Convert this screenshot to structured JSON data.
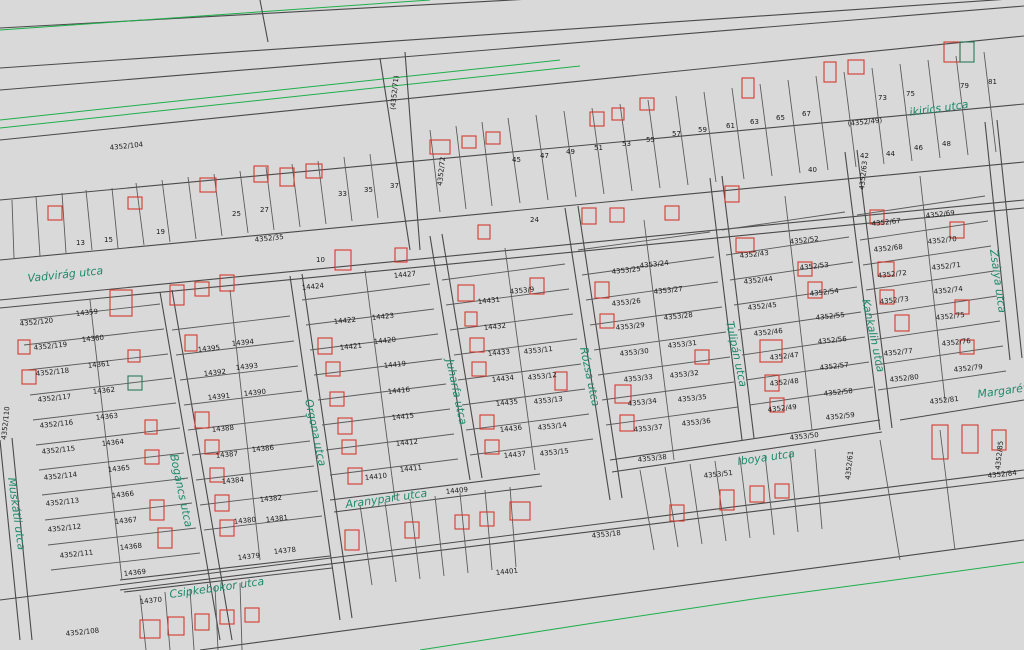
{
  "colors": {
    "background": "#d9d9d9",
    "parcel_line": "#5b5b5b",
    "building": "#d43a2f",
    "street_label": "#1e8a6a",
    "contour": "#1fae4b"
  },
  "streets": {
    "vadvirag": "Vadvirág utca",
    "bogancs": "Bogáncs utca",
    "orgona": "Orgona utca",
    "juharfa": "Juharfa utca",
    "rozsa": "Rózsa utca",
    "tulipan": "Tulipán utca",
    "kankalin": "Kankalin utca",
    "zsalya": "Zsálya utca",
    "margareta": "Margaréta",
    "iboya": "Iboya utca",
    "aranypart": "Aranypart utca",
    "csipkebokor": "Csipkebokor utca",
    "muskatli": "Muskátli utca",
    "kikirics": "ikirics utca"
  },
  "parcels": {
    "p4352_104": "4352/104",
    "p4352_49": "(4352/49)",
    "p4352_35": "4352/35",
    "p4352_71": "(4352/71)",
    "p4352_72": "4352/72",
    "p4352_120": "4352/120",
    "p4352_119": "4352/119",
    "p4352_118": "4352/118",
    "p4352_117": "4352/117",
    "p4352_116": "4352/116",
    "p4352_115": "4352/115",
    "p4352_114": "4352/114",
    "p4352_113": "4352/113",
    "p4352_112": "4352/112",
    "p4352_111": "4352/111",
    "p4352_108": "4352/108",
    "p4352_110": "4352/110",
    "p4353_18": "4353/18",
    "p4353_51": "4353/51",
    "p4353_50": "4353/50",
    "p4352_61": "4352/61",
    "p4352_63": "4352/63",
    "p4352_81": "4352/81",
    "p4352_85": "4352/85",
    "p4352_84": "4352/84",
    "n14359": "14359",
    "n14360": "14360",
    "n14361": "14361",
    "n14362": "14362",
    "n14363": "14363",
    "n14364": "14364",
    "n14365": "14365",
    "n14366": "14366",
    "n14367": "14367",
    "n14368": "14368",
    "n14369": "14369",
    "n14370": "14370",
    "n14401": "14401",
    "n14409": "14409",
    "n14424": "14424",
    "n14422": "14422",
    "n14421": "14421",
    "n14420": "14420",
    "n14419": "14419",
    "n14416": "14416",
    "n14415": "14415",
    "n14412": "14412",
    "n14411": "14411",
    "n14410": "14410",
    "n14423": "14423",
    "n14427": "14427",
    "n14431": "14431",
    "n14432": "14432",
    "n14433": "14433",
    "n14434": "14434",
    "n14435": "14435",
    "n14436": "14436",
    "n14437": "14437",
    "n14394": "14394",
    "n14393": "14393",
    "n14392": "14392",
    "n14391": "14391",
    "n14390": "14390",
    "n14395": "14395",
    "n14388": "14388",
    "n14387": "14387",
    "n14386": "14386",
    "n14384": "14384",
    "n14382": "14382",
    "n14381": "14381",
    "n14380": "14380",
    "n14379": "14379",
    "n14378": "14378",
    "r4353_24": "4353/24",
    "r4353_25": "4353/25",
    "r4353_26": "4353/26",
    "r4353_27": "4353/27",
    "r4353_28": "4353/28",
    "r4353_29": "4353/29",
    "r4353_30": "4353/30",
    "r4353_31": "4353/31",
    "r4353_32": "4353/32",
    "r4353_33": "4353/33",
    "r4353_34": "4353/34",
    "r4353_35": "4353/35",
    "r4353_36": "4353/36",
    "r4353_37": "4353/37",
    "r4353_38": "4353/38",
    "r4353_9": "4353/9",
    "r4353_11": "4353/11",
    "r4353_12": "4353/12",
    "r4353_13": "4353/13",
    "r4353_14": "4353/14",
    "r4353_15": "4353/15",
    "r4352_43": "4352/43",
    "r4352_44": "4352/44",
    "r4352_45": "4352/45",
    "r4352_46": "4352/46",
    "r4352_47": "4352/47",
    "r4352_48": "4352/48",
    "r4352_49": "4352/49",
    "r4352_52": "4352/52",
    "r4352_53": "4352/53",
    "r4352_54": "4352/54",
    "r4352_55": "4352/55",
    "r4352_56": "4352/56",
    "r4352_57": "4352/57",
    "r4352_58": "4352/58",
    "r4352_59": "4352/59",
    "r4352_67": "4352/67",
    "r4352_68": "4352/68",
    "r4352_69": "4352/69",
    "r4352_70": "4352/70",
    "r4352_71": "4352/71",
    "r4352_72": "4352/72",
    "r4352_73": "4352/73",
    "r4352_74": "4352/74",
    "r4352_75": "4352/75",
    "r4352_76": "4352/76",
    "r4352_77": "4352/77",
    "r4352_79": "4352/79",
    "r4352_80": "4352/80",
    "h13": "13",
    "h15": "15",
    "h19": "19",
    "h25": "25",
    "h27": "27",
    "h33": "33",
    "h35": "35",
    "h37": "37",
    "h45": "45",
    "h47": "47",
    "h49": "49",
    "h51": "51",
    "h53": "53",
    "h55": "55",
    "h57": "57",
    "h59": "59",
    "h61": "61",
    "h63": "63",
    "h65": "65",
    "h67": "67",
    "h73": "73",
    "h75": "75",
    "h79": "79",
    "h81": "81",
    "h10": "10",
    "h24": "24",
    "h40": "40",
    "h42": "42",
    "h44": "44",
    "h46": "46",
    "h48": "48"
  }
}
